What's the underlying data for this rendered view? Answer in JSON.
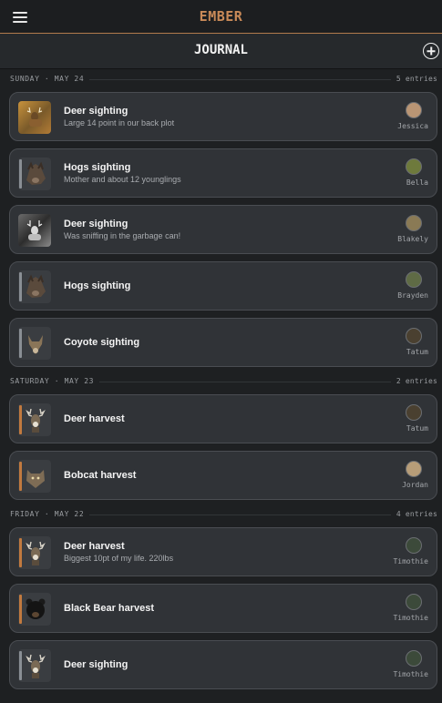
{
  "app": {
    "brand": "EMBER"
  },
  "header": {
    "title": "JOURNAL"
  },
  "sections": [
    {
      "label": "SUNDAY · MAY 24",
      "count": "5 entries",
      "entries": [
        {
          "title": "Deer sighting",
          "subtitle": "Large 14 point in our back plot",
          "user": "Jessica",
          "kind": "sighting",
          "icon": "deer-photo-icon",
          "avatar_color": "#b99574"
        },
        {
          "title": "Hogs sighting",
          "subtitle": "Mother and about 12 younglings",
          "user": "Bella",
          "kind": "sighting",
          "icon": "hog-icon",
          "avatar_color": "#6e7a3c"
        },
        {
          "title": "Deer sighting",
          "subtitle": "Was sniffing in the garbage can!",
          "user": "Blakely",
          "kind": "sighting",
          "icon": "deer-trailcam-icon",
          "avatar_color": "#8a7a55"
        },
        {
          "title": "Hogs sighting",
          "subtitle": "",
          "user": "Brayden",
          "kind": "sighting",
          "icon": "hog-icon",
          "avatar_color": "#5f6b45"
        },
        {
          "title": "Coyote sighting",
          "subtitle": "",
          "user": "Tatum",
          "kind": "sighting",
          "icon": "coyote-icon",
          "avatar_color": "#4a4030"
        }
      ]
    },
    {
      "label": "SATURDAY · MAY 23",
      "count": "2 entries",
      "entries": [
        {
          "title": "Deer harvest",
          "subtitle": "",
          "user": "Tatum",
          "kind": "harvest",
          "icon": "deer-icon",
          "avatar_color": "#4a4030"
        },
        {
          "title": "Bobcat harvest",
          "subtitle": "",
          "user": "Jordan",
          "kind": "harvest",
          "icon": "bobcat-icon",
          "avatar_color": "#b79d78"
        }
      ]
    },
    {
      "label": "FRIDAY · MAY 22",
      "count": "4 entries",
      "entries": [
        {
          "title": "Deer harvest",
          "subtitle": "Biggest 10pt of my life. 220lbs",
          "user": "Timothie",
          "kind": "harvest",
          "icon": "deer-icon",
          "avatar_color": "#3c4a3a"
        },
        {
          "title": "Black Bear harvest",
          "subtitle": "",
          "user": "Timothie",
          "kind": "harvest",
          "icon": "bear-icon",
          "avatar_color": "#3c4a3a"
        },
        {
          "title": "Deer sighting",
          "subtitle": "",
          "user": "Timothie",
          "kind": "sighting",
          "icon": "deer-icon",
          "avatar_color": "#3c4a3a"
        }
      ]
    }
  ]
}
